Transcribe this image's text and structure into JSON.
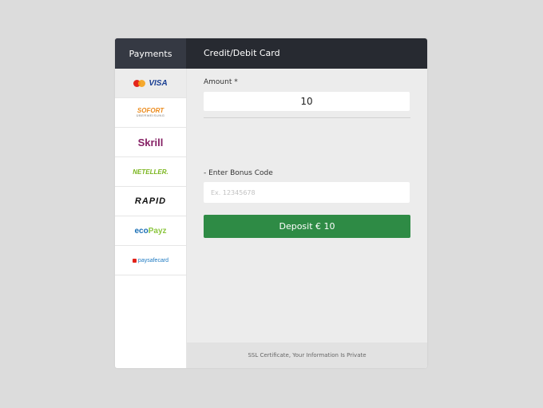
{
  "header": {
    "payments_tab": "Payments",
    "method_title": "Credit/Debit Card"
  },
  "sidebar": {
    "methods": [
      {
        "name": "credit-debit-card",
        "logo_text": "VISA"
      },
      {
        "name": "sofort",
        "logo_text": "SOFORT",
        "logo_subtext": "ÜBERWEISUNG"
      },
      {
        "name": "skrill",
        "logo_text": "Skrill"
      },
      {
        "name": "neteller",
        "logo_text": "NETELLER."
      },
      {
        "name": "rapid",
        "logo_text": "RAPID"
      },
      {
        "name": "ecopayz",
        "logo_text_eco": "eco",
        "logo_text_payz": "Payz"
      },
      {
        "name": "paysafecard",
        "logo_text": "paysafecard"
      }
    ]
  },
  "form": {
    "amount_label": "Amount *",
    "amount_value": "10",
    "bonus_label": "- Enter Bonus Code",
    "bonus_placeholder": "Ex. 12345678",
    "deposit_label": "Deposit € 10"
  },
  "footer": {
    "text": "SSL Certificate, Your Information Is Private"
  },
  "colors": {
    "header_bg": "#272a31",
    "deposit_button": "#2e8b45",
    "content_bg": "#ececec"
  }
}
